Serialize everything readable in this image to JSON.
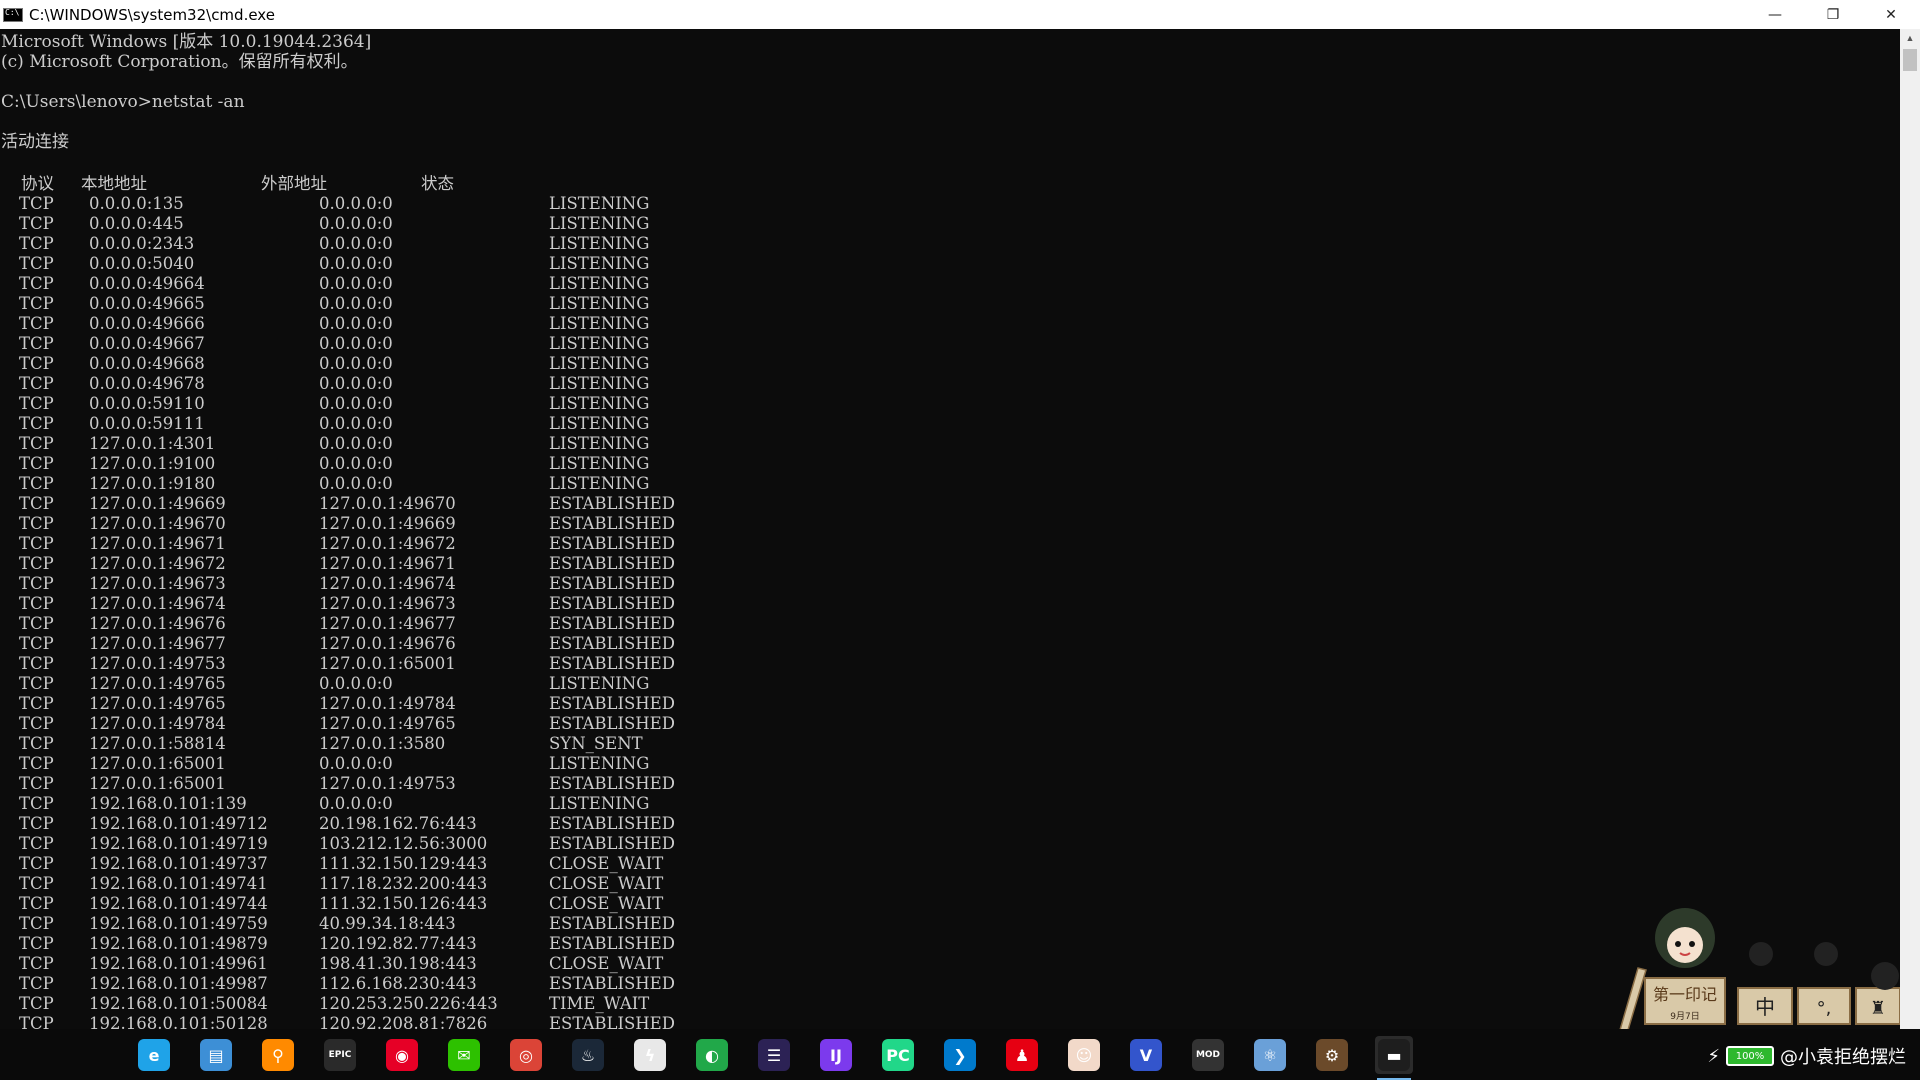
{
  "window": {
    "title": "C:\\WINDOWS\\system32\\cmd.exe",
    "minimize": "—",
    "restore": "❐",
    "close": "✕"
  },
  "console": {
    "header_lines": [
      "Microsoft Windows [版本 10.0.19044.2364]",
      "(c) Microsoft Corporation。保留所有权利。",
      "",
      "C:\\Users\\lenovo>netstat -an",
      "",
      "活动连接",
      ""
    ],
    "columns": [
      "协议",
      "本地地址",
      "外部地址",
      "状态"
    ],
    "rows": [
      [
        "TCP",
        "0.0.0.0:135",
        "0.0.0.0:0",
        "LISTENING"
      ],
      [
        "TCP",
        "0.0.0.0:445",
        "0.0.0.0:0",
        "LISTENING"
      ],
      [
        "TCP",
        "0.0.0.0:2343",
        "0.0.0.0:0",
        "LISTENING"
      ],
      [
        "TCP",
        "0.0.0.0:5040",
        "0.0.0.0:0",
        "LISTENING"
      ],
      [
        "TCP",
        "0.0.0.0:49664",
        "0.0.0.0:0",
        "LISTENING"
      ],
      [
        "TCP",
        "0.0.0.0:49665",
        "0.0.0.0:0",
        "LISTENING"
      ],
      [
        "TCP",
        "0.0.0.0:49666",
        "0.0.0.0:0",
        "LISTENING"
      ],
      [
        "TCP",
        "0.0.0.0:49667",
        "0.0.0.0:0",
        "LISTENING"
      ],
      [
        "TCP",
        "0.0.0.0:49668",
        "0.0.0.0:0",
        "LISTENING"
      ],
      [
        "TCP",
        "0.0.0.0:49678",
        "0.0.0.0:0",
        "LISTENING"
      ],
      [
        "TCP",
        "0.0.0.0:59110",
        "0.0.0.0:0",
        "LISTENING"
      ],
      [
        "TCP",
        "0.0.0.0:59111",
        "0.0.0.0:0",
        "LISTENING"
      ],
      [
        "TCP",
        "127.0.0.1:4301",
        "0.0.0.0:0",
        "LISTENING"
      ],
      [
        "TCP",
        "127.0.0.1:9100",
        "0.0.0.0:0",
        "LISTENING"
      ],
      [
        "TCP",
        "127.0.0.1:9180",
        "0.0.0.0:0",
        "LISTENING"
      ],
      [
        "TCP",
        "127.0.0.1:49669",
        "127.0.0.1:49670",
        "ESTABLISHED"
      ],
      [
        "TCP",
        "127.0.0.1:49670",
        "127.0.0.1:49669",
        "ESTABLISHED"
      ],
      [
        "TCP",
        "127.0.0.1:49671",
        "127.0.0.1:49672",
        "ESTABLISHED"
      ],
      [
        "TCP",
        "127.0.0.1:49672",
        "127.0.0.1:49671",
        "ESTABLISHED"
      ],
      [
        "TCP",
        "127.0.0.1:49673",
        "127.0.0.1:49674",
        "ESTABLISHED"
      ],
      [
        "TCP",
        "127.0.0.1:49674",
        "127.0.0.1:49673",
        "ESTABLISHED"
      ],
      [
        "TCP",
        "127.0.0.1:49676",
        "127.0.0.1:49677",
        "ESTABLISHED"
      ],
      [
        "TCP",
        "127.0.0.1:49677",
        "127.0.0.1:49676",
        "ESTABLISHED"
      ],
      [
        "TCP",
        "127.0.0.1:49753",
        "127.0.0.1:65001",
        "ESTABLISHED"
      ],
      [
        "TCP",
        "127.0.0.1:49765",
        "0.0.0.0:0",
        "LISTENING"
      ],
      [
        "TCP",
        "127.0.0.1:49765",
        "127.0.0.1:49784",
        "ESTABLISHED"
      ],
      [
        "TCP",
        "127.0.0.1:49784",
        "127.0.0.1:49765",
        "ESTABLISHED"
      ],
      [
        "TCP",
        "127.0.0.1:58814",
        "127.0.0.1:3580",
        "SYN_SENT"
      ],
      [
        "TCP",
        "127.0.0.1:65001",
        "0.0.0.0:0",
        "LISTENING"
      ],
      [
        "TCP",
        "127.0.0.1:65001",
        "127.0.0.1:49753",
        "ESTABLISHED"
      ],
      [
        "TCP",
        "192.168.0.101:139",
        "0.0.0.0:0",
        "LISTENING"
      ],
      [
        "TCP",
        "192.168.0.101:49712",
        "20.198.162.76:443",
        "ESTABLISHED"
      ],
      [
        "TCP",
        "192.168.0.101:49719",
        "103.212.12.56:3000",
        "ESTABLISHED"
      ],
      [
        "TCP",
        "192.168.0.101:49737",
        "111.32.150.129:443",
        "CLOSE_WAIT"
      ],
      [
        "TCP",
        "192.168.0.101:49741",
        "117.18.232.200:443",
        "CLOSE_WAIT"
      ],
      [
        "TCP",
        "192.168.0.101:49744",
        "111.32.150.126:443",
        "CLOSE_WAIT"
      ],
      [
        "TCP",
        "192.168.0.101:49759",
        "40.99.34.18:443",
        "ESTABLISHED"
      ],
      [
        "TCP",
        "192.168.0.101:49879",
        "120.192.82.77:443",
        "ESTABLISHED"
      ],
      [
        "TCP",
        "192.168.0.101:49961",
        "198.41.30.198:443",
        "CLOSE_WAIT"
      ],
      [
        "TCP",
        "192.168.0.101:49987",
        "112.6.168.230:443",
        "ESTABLISHED"
      ],
      [
        "TCP",
        "192.168.0.101:50084",
        "120.253.250.226:443",
        "TIME_WAIT"
      ],
      [
        "TCP",
        "192.168.0.101:50128",
        "120.92.208.81:7826",
        "ESTABLISHED"
      ]
    ]
  },
  "taskbar": {
    "icons": [
      {
        "name": "edge-icon",
        "glyph": "e",
        "color": "#1fa3e8"
      },
      {
        "name": "file-explorer-icon",
        "glyph": "▤",
        "color": "#3d8fd6"
      },
      {
        "name": "search-app-icon",
        "glyph": "⚲",
        "color": "#ff8a00"
      },
      {
        "name": "epic-games-icon",
        "glyph": "EPIC",
        "color": "#2a2a2a"
      },
      {
        "name": "netease-music-icon",
        "glyph": "◉",
        "color": "#e60026"
      },
      {
        "name": "wechat-icon",
        "glyph": "✉",
        "color": "#2dc100"
      },
      {
        "name": "chrome-icon",
        "glyph": "◎",
        "color": "#db4437"
      },
      {
        "name": "steam-icon",
        "glyph": "♨",
        "color": "#1b2838"
      },
      {
        "name": "thunder-icon",
        "glyph": "ϟ",
        "color": "#e8e8e8"
      },
      {
        "name": "green-app-icon",
        "glyph": "◐",
        "color": "#21a849"
      },
      {
        "name": "eclipse-icon",
        "glyph": "☰",
        "color": "#2c2255"
      },
      {
        "name": "intellij-icon",
        "glyph": "IJ",
        "color": "#7c3aed"
      },
      {
        "name": "pycharm-icon",
        "glyph": "PC",
        "color": "#21d789"
      },
      {
        "name": "vscode-icon",
        "glyph": "❯",
        "color": "#007acc"
      },
      {
        "name": "qq-icon",
        "glyph": "♟",
        "color": "#e60012"
      },
      {
        "name": "anime-app-icon",
        "glyph": "☺",
        "color": "#f2d9c9"
      },
      {
        "name": "v-app-icon",
        "glyph": "V",
        "color": "#3355cc"
      },
      {
        "name": "modbox-icon",
        "glyph": "MOD",
        "color": "#333333"
      },
      {
        "name": "atom-app-icon",
        "glyph": "⚛",
        "color": "#6aa0d8"
      },
      {
        "name": "settings-app-icon",
        "glyph": "⚙",
        "color": "#6b4a2a"
      },
      {
        "name": "cmd-icon",
        "glyph": "▬",
        "color": "#1e1e1e",
        "active": true
      }
    ],
    "tray_text": "@小袁拒绝摆烂",
    "battery_percent": "100%"
  },
  "sticker": {
    "caption": "9月7日"
  }
}
